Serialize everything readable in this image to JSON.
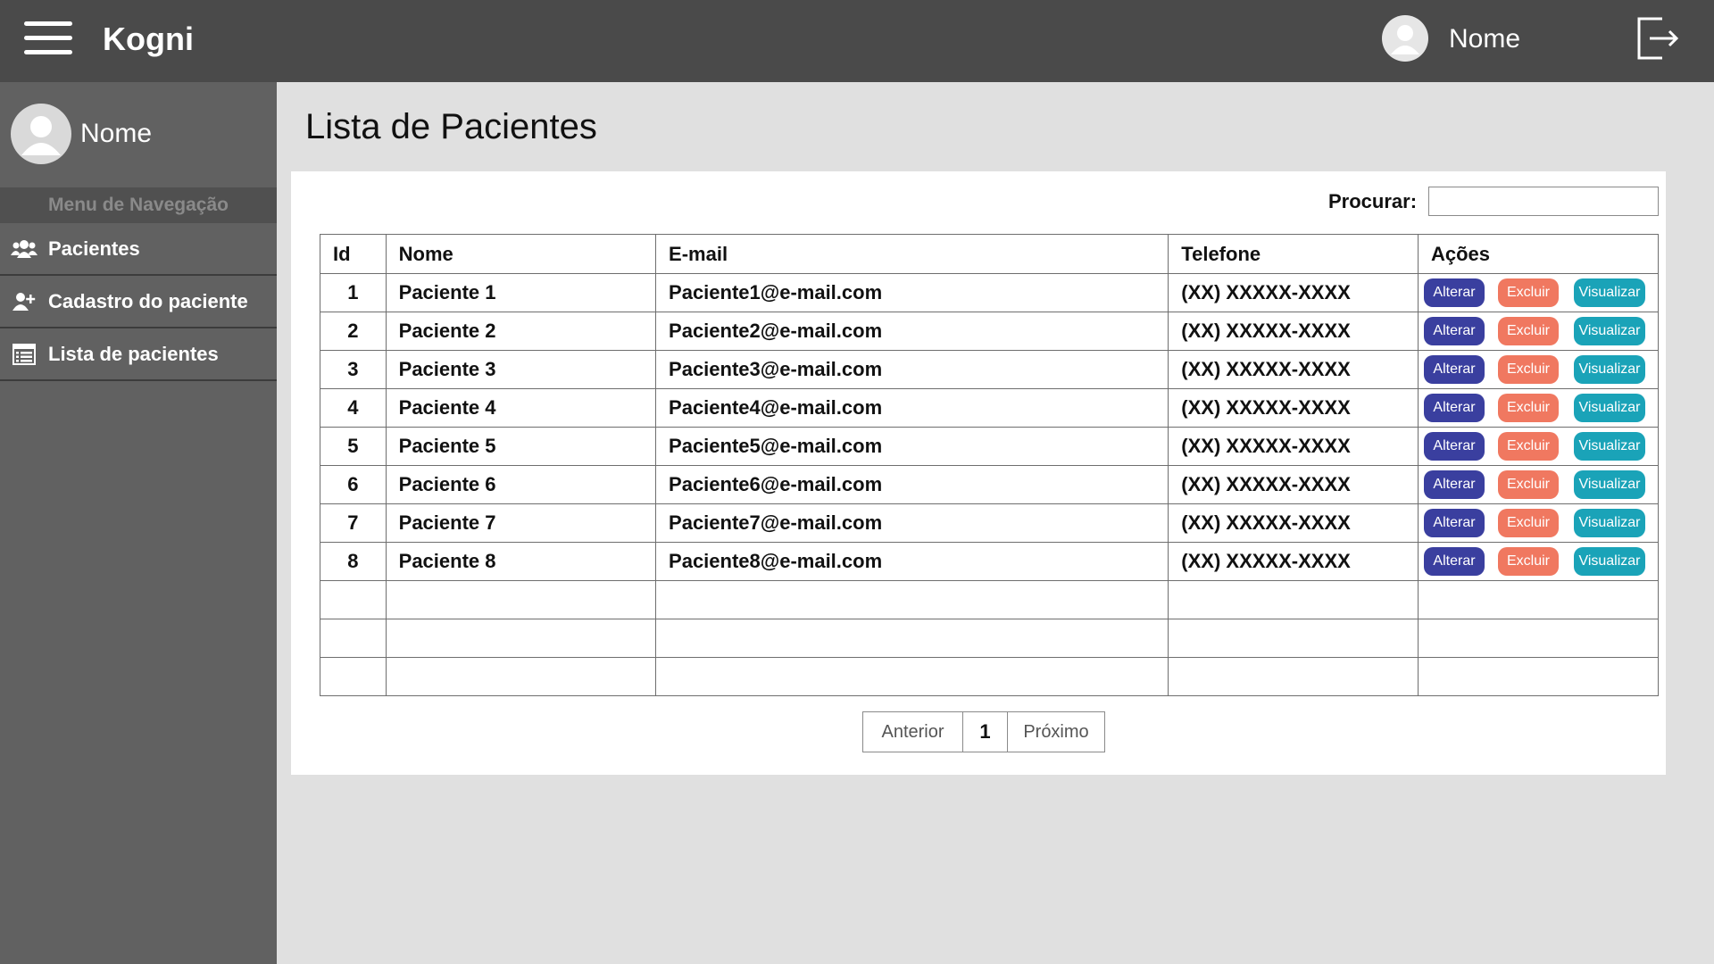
{
  "app": {
    "title": "Kogni"
  },
  "header": {
    "username": "Nome"
  },
  "sidebar": {
    "username": "Nome",
    "menu_title": "Menu de Navegação",
    "items": [
      {
        "label": "Pacientes",
        "icon": "users-icon"
      },
      {
        "label": "Cadastro do paciente",
        "icon": "user-plus-icon"
      },
      {
        "label": "Lista de pacientes",
        "icon": "list-icon"
      }
    ]
  },
  "main": {
    "title": "Lista de Pacientes",
    "search": {
      "label": "Procurar:",
      "value": "",
      "placeholder": ""
    },
    "table": {
      "columns": [
        "Id",
        "Nome",
        "E-mail",
        "Telefone",
        "Ações"
      ],
      "actions": {
        "edit": "Alterar",
        "delete": "Excluir",
        "view": "Visualizar"
      },
      "rows": [
        {
          "id": "1",
          "name": "Paciente 1",
          "email": "Paciente1@e-mail.com",
          "phone": "(XX) XXXXX-XXXX"
        },
        {
          "id": "2",
          "name": "Paciente 2",
          "email": "Paciente2@e-mail.com",
          "phone": "(XX) XXXXX-XXXX"
        },
        {
          "id": "3",
          "name": "Paciente 3",
          "email": "Paciente3@e-mail.com",
          "phone": "(XX) XXXXX-XXXX"
        },
        {
          "id": "4",
          "name": "Paciente 4",
          "email": "Paciente4@e-mail.com",
          "phone": "(XX) XXXXX-XXXX"
        },
        {
          "id": "5",
          "name": "Paciente 5",
          "email": "Paciente5@e-mail.com",
          "phone": "(XX) XXXXX-XXXX"
        },
        {
          "id": "6",
          "name": "Paciente 6",
          "email": "Paciente6@e-mail.com",
          "phone": "(XX) XXXXX-XXXX"
        },
        {
          "id": "7",
          "name": "Paciente 7",
          "email": "Paciente7@e-mail.com",
          "phone": "(XX) XXXXX-XXXX"
        },
        {
          "id": "8",
          "name": "Paciente 8",
          "email": "Paciente8@e-mail.com",
          "phone": "(XX) XXXXX-XXXX"
        }
      ],
      "empty_rows": 3
    },
    "pagination": {
      "prev": "Anterior",
      "current": "1",
      "next": "Próximo"
    }
  },
  "colors": {
    "topbar": "#4a4a4a",
    "sidebar": "#616161",
    "alterar": "#3a3f9f",
    "excluir": "#f07860",
    "visualizar": "#1aa3b8"
  }
}
